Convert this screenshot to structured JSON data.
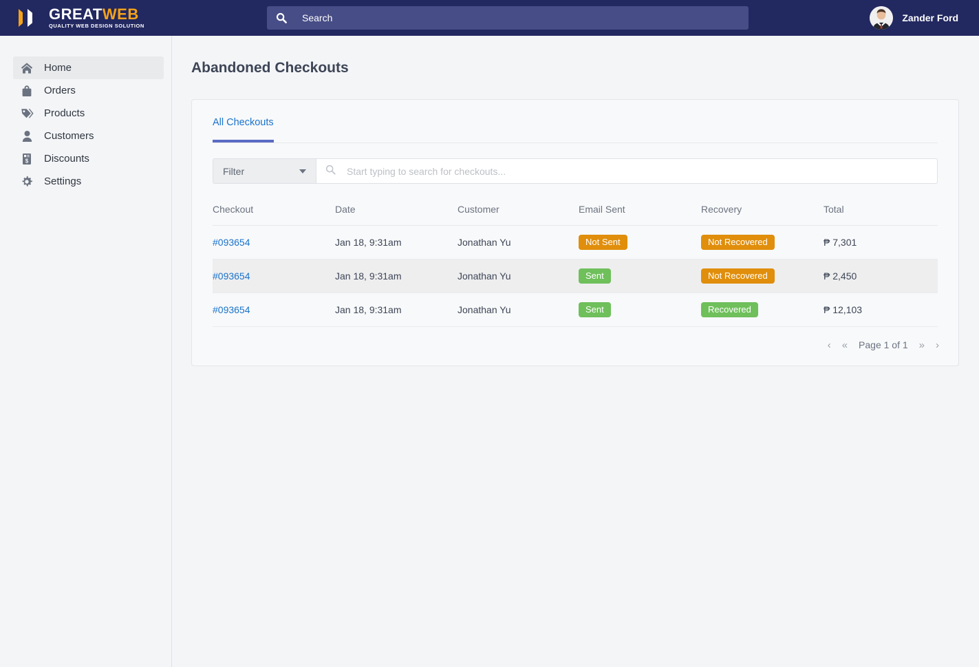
{
  "brand": {
    "name_part1": "GREAT",
    "name_part2": "WEB",
    "tagline": "QUALITY WEB DESIGN SOLUTION",
    "accent_color": "#f5a318",
    "header_color": "#222860"
  },
  "header": {
    "search_placeholder": "Search",
    "search_value": "",
    "user_name": "Zander Ford"
  },
  "sidebar": {
    "items": [
      {
        "label": "Home",
        "icon": "home-icon",
        "active": true
      },
      {
        "label": "Orders",
        "icon": "bag-icon",
        "active": false
      },
      {
        "label": "Products",
        "icon": "tag-icon",
        "active": false
      },
      {
        "label": "Customers",
        "icon": "user-icon",
        "active": false
      },
      {
        "label": "Discounts",
        "icon": "discount-document-icon",
        "active": false
      },
      {
        "label": "Settings",
        "icon": "gear-icon",
        "active": false
      }
    ]
  },
  "main": {
    "page_title": "Abandoned Checkouts",
    "tabs": [
      {
        "label": "All Checkouts",
        "active": true
      }
    ],
    "filter": {
      "label": "Filter",
      "search_placeholder": "Start typing to search for checkouts...",
      "search_value": ""
    },
    "table": {
      "columns": [
        "Checkout",
        "Date",
        "Customer",
        "Email Sent",
        "Recovery",
        "Total"
      ],
      "rows": [
        {
          "checkout": "#093654",
          "date": "Jan 18, 9:31am",
          "customer": "Jonathan Yu",
          "email_sent": "Not Sent",
          "email_sent_state": "warn",
          "recovery": "Not Recovered",
          "recovery_state": "warn",
          "total": "₱ 7,301"
        },
        {
          "checkout": "#093654",
          "date": "Jan 18, 9:31am",
          "customer": "Jonathan Yu",
          "email_sent": "Sent",
          "email_sent_state": "ok",
          "recovery": "Not Recovered",
          "recovery_state": "warn",
          "total": "₱ 2,450"
        },
        {
          "checkout": "#093654",
          "date": "Jan 18, 9:31am",
          "customer": "Jonathan Yu",
          "email_sent": "Sent",
          "email_sent_state": "ok",
          "recovery": "Recovered",
          "recovery_state": "ok",
          "total": "₱ 12,103"
        }
      ]
    },
    "pagination": {
      "prev": "‹",
      "first": "«",
      "label": "Page 1 of 1",
      "last": "»",
      "next": "›"
    }
  },
  "colors": {
    "badge_warn": "#e08e0b",
    "badge_ok": "#6fbf5b",
    "link": "#1a73cc",
    "tab_underline": "#5b6ac4"
  }
}
